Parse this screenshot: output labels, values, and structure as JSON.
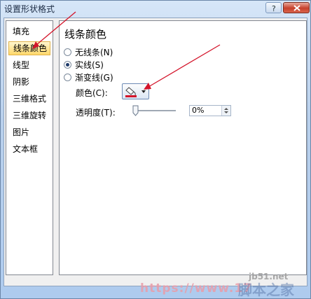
{
  "window": {
    "title": "设置形状格式"
  },
  "nav": {
    "items": [
      "填充",
      "线条颜色",
      "线型",
      "阴影",
      "三维格式",
      "三维旋转",
      "图片",
      "文本框"
    ]
  },
  "panel": {
    "heading": "线条颜色",
    "options": [
      "无线条(N)",
      "实线(S)",
      "渐变线(G)"
    ],
    "selected_option": "实线(S)",
    "color_label": "颜色(C):",
    "transparency_label": "透明度(T):",
    "transparency_value": "0%"
  },
  "watermarks": {
    "url": "https://www.17",
    "domain": "jb51.net",
    "site": "脚本之家"
  },
  "colors": {
    "accent_red": "#d4142a",
    "selected_nav": "#ffd86b"
  }
}
